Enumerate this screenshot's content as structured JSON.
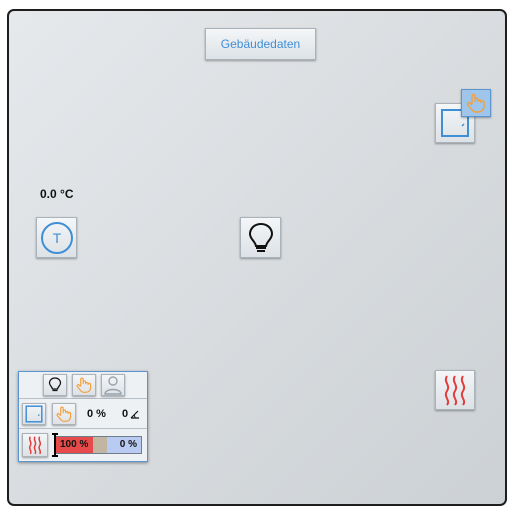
{
  "header": {
    "button_label": "Gebäudedaten"
  },
  "temperature": {
    "value": "0.0 °C",
    "sensor_letter": "T"
  },
  "panel": {
    "shade_position": "0 %",
    "tilt_angle": "0",
    "heating_value": "100 %",
    "cooling_value": "0 %",
    "heating_level": 0.8,
    "cooling_level": 0.0
  },
  "colors": {
    "accent": "#3f8fd6",
    "hand": "#f2a03d",
    "heat": "#e23b3b"
  }
}
